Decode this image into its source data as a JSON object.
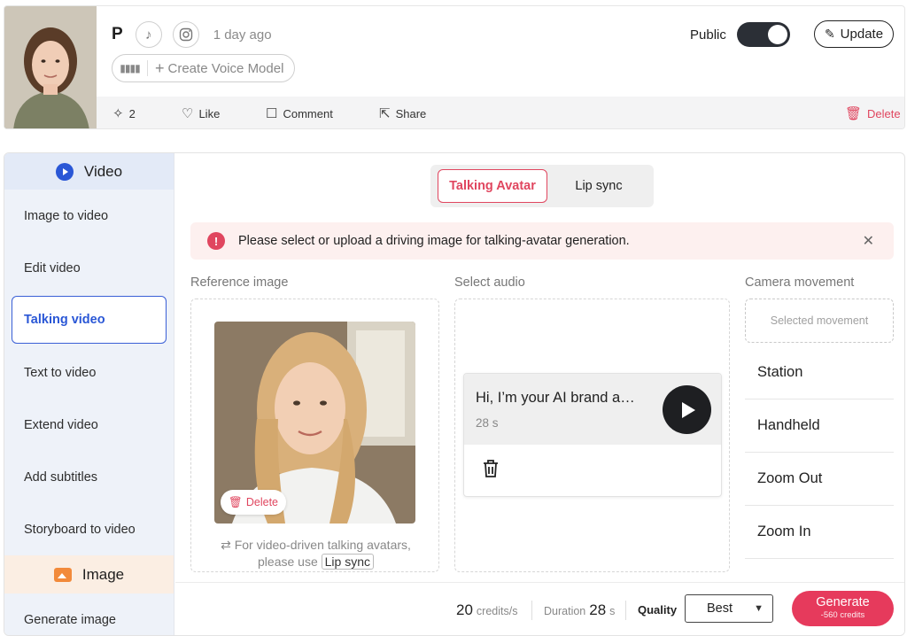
{
  "profile": {
    "name": "P",
    "time_ago": "1 day ago",
    "create_voice_model": "Create Voice Model",
    "public_label": "Public",
    "public_on": true,
    "update_label": "Update"
  },
  "actions": {
    "sparkle_count": "2",
    "like": "Like",
    "comment": "Comment",
    "share": "Share",
    "delete": "Delete"
  },
  "sidebar": {
    "video_header": "Video",
    "items": [
      {
        "label": "Image to video"
      },
      {
        "label": "Edit video"
      },
      {
        "label": "Talking video",
        "active": true
      },
      {
        "label": "Text to video"
      },
      {
        "label": "Extend video"
      },
      {
        "label": "Add subtitles"
      },
      {
        "label": "Storyboard to video"
      }
    ],
    "image_header": "Image",
    "image_items": [
      {
        "label": "Generate image"
      }
    ]
  },
  "mode_tabs": {
    "active": "Talking Avatar",
    "other": "Lip sync"
  },
  "alert": {
    "message": "Please select or upload a driving image for talking-avatar generation."
  },
  "reference": {
    "label": "Reference image",
    "delete_label": "Delete",
    "hint_line1": "For video-driven talking avatars,",
    "hint_prefix": "please use",
    "hint_link": "Lip sync"
  },
  "audio": {
    "label": "Select audio",
    "title": "Hi, I’m your AI brand a…",
    "duration": "28 s"
  },
  "camera": {
    "label": "Camera movement",
    "placeholder": "Selected movement",
    "options": [
      "Station",
      "Handheld",
      "Zoom Out",
      "Zoom In"
    ]
  },
  "footer": {
    "credits_value": "20",
    "credits_unit": "credits/s",
    "duration_label": "Duration",
    "duration_value": "28",
    "duration_unit": "s",
    "quality_label": "Quality",
    "quality_value": "Best",
    "generate_label": "Generate",
    "generate_cost": "-560 credits"
  },
  "colors": {
    "accent": "#e0465f",
    "primary_blue": "#2a57d6",
    "generate": "#e63a5c"
  }
}
